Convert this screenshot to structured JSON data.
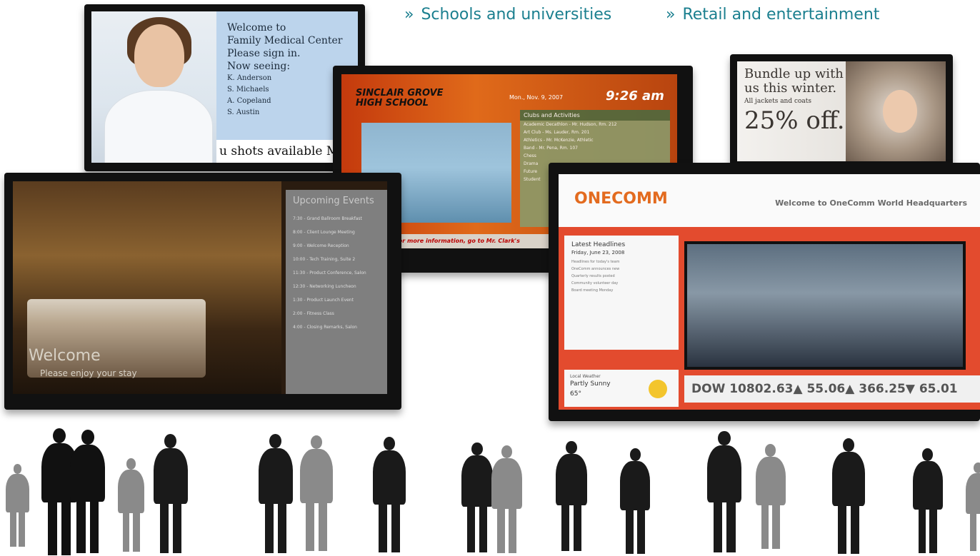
{
  "header_links": [
    {
      "chevron": "»",
      "label": "Schools and universities"
    },
    {
      "chevron": "»",
      "label": "Retail and entertainment"
    }
  ],
  "medical": {
    "title_line1": "Welcome to",
    "title_line2": "Family Medical Center",
    "line3": "Please sign in.",
    "line4": "Now seeing:",
    "patients": [
      "K. Anderson",
      "S. Michaels",
      "A. Copeland",
      "S. Austin"
    ],
    "ticker": "u shots available Mo"
  },
  "school": {
    "name_line1": "SINCLAIR GROVE",
    "name_line2": "HIGH SCHOOL",
    "date": "Mon., Nov. 9, 2007",
    "time": "9:26 am",
    "panel_header": "Clubs and Activities",
    "rows": [
      "Academic Decathlon - Mr. Hudson, Rm. 212",
      "Art Club - Ms. Lauder, Rm. 201",
      "Athletics - Mr. McKenzie, Athletic",
      "Band - Mr. Pena, Rm. 107",
      "Chess",
      "Drama",
      "Future",
      "Student"
    ],
    "bottom_bar": "Notice: For more information, go to Mr. Clark's"
  },
  "retail": {
    "line1": "Bundle up with",
    "line2": "us this winter.",
    "line3": "All jackets and coats",
    "offer": "25% off."
  },
  "hotel": {
    "welcome": "Welcome",
    "enjoy": "Please enjoy your stay",
    "panel_title": "Upcoming Events",
    "events": [
      "7:30 - Grand Ballroom Breakfast",
      "8:00 - Client Lounge Meeting",
      "9:00 - Welcome Reception",
      "10:00 - Tech Training, Suite 2",
      "11:30 - Product Conference, Salon",
      "12:30 - Networking Luncheon",
      "1:30 - Product Launch Event",
      "2:00 - Fitness Class",
      "4:00 - Closing Remarks, Salon"
    ]
  },
  "corporate": {
    "logo": "ONECOMM",
    "welcome": "Welcome to OneComm World Headquarters",
    "news_header": "Latest Headlines",
    "news_date": "Friday, June 23, 2008",
    "news_items": [
      "Headlines for today's team",
      "OneComm announces new",
      "Quarterly results posted",
      "Community volunteer day",
      "Board meeting Monday"
    ],
    "weather_label": "Local Weather",
    "weather_value": "Partly Sunny",
    "weather_temp": "65°",
    "ticker": "DOW 10802.63▲  55.06▲  366.25▼  65.01"
  },
  "colors": {
    "link_teal": "#1b7f8f",
    "onecomm_red": "#e34b2e",
    "school_orange": "#e06a1a"
  }
}
